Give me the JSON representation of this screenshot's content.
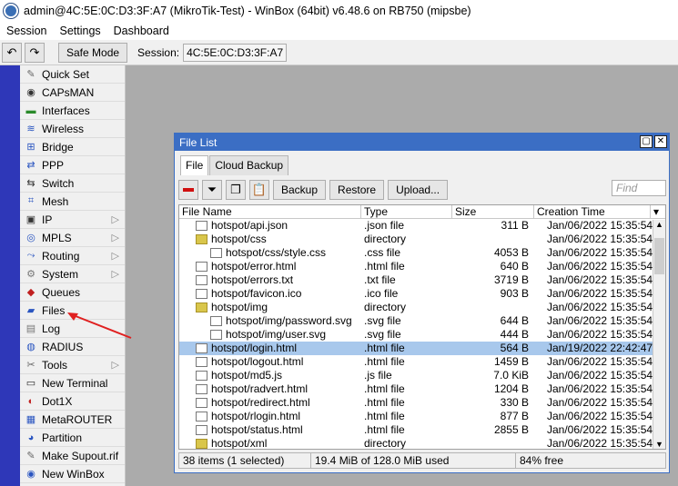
{
  "window_title": "admin@4C:5E:0C:D3:3F:A7 (MikroTik-Test) - WinBox (64bit) v6.48.6 on RB750 (mipsbe)",
  "menu": [
    "Session",
    "Settings",
    "Dashboard"
  ],
  "toolbar": {
    "undo_icon": "undo-icon",
    "redo_icon": "redo-icon",
    "safe_mode": "Safe Mode",
    "session_label": "Session:",
    "session_value": "4C:5E:0C:D3:3F:A7"
  },
  "sidebar": [
    {
      "label": "Quick Set",
      "icon": "wand-icon",
      "arrow": false
    },
    {
      "label": "CAPsMAN",
      "icon": "capsman-icon",
      "arrow": false
    },
    {
      "label": "Interfaces",
      "icon": "interfaces-icon",
      "arrow": false
    },
    {
      "label": "Wireless",
      "icon": "wireless-icon",
      "arrow": false
    },
    {
      "label": "Bridge",
      "icon": "bridge-icon",
      "arrow": false
    },
    {
      "label": "PPP",
      "icon": "ppp-icon",
      "arrow": false
    },
    {
      "label": "Switch",
      "icon": "switch-icon",
      "arrow": false
    },
    {
      "label": "Mesh",
      "icon": "mesh-icon",
      "arrow": false
    },
    {
      "label": "IP",
      "icon": "ip-icon",
      "arrow": true
    },
    {
      "label": "MPLS",
      "icon": "mpls-icon",
      "arrow": true
    },
    {
      "label": "Routing",
      "icon": "routing-icon",
      "arrow": true
    },
    {
      "label": "System",
      "icon": "gear-icon",
      "arrow": true
    },
    {
      "label": "Queues",
      "icon": "queues-icon",
      "arrow": false
    },
    {
      "label": "Files",
      "icon": "folder-icon",
      "arrow": false
    },
    {
      "label": "Log",
      "icon": "log-icon",
      "arrow": false
    },
    {
      "label": "RADIUS",
      "icon": "radius-icon",
      "arrow": false
    },
    {
      "label": "Tools",
      "icon": "tools-icon",
      "arrow": true
    },
    {
      "label": "New Terminal",
      "icon": "terminal-icon",
      "arrow": false
    },
    {
      "label": "Dot1X",
      "icon": "dot1x-icon",
      "arrow": false
    },
    {
      "label": "MetaROUTER",
      "icon": "metarouter-icon",
      "arrow": false
    },
    {
      "label": "Partition",
      "icon": "partition-icon",
      "arrow": false
    },
    {
      "label": "Make Supout.rif",
      "icon": "supout-icon",
      "arrow": false
    },
    {
      "label": "New WinBox",
      "icon": "winbox-icon",
      "arrow": false
    }
  ],
  "file_window": {
    "title": "File List",
    "tabs": [
      "File",
      "Cloud Backup"
    ],
    "buttons": {
      "backup": "Backup",
      "restore": "Restore",
      "upload": "Upload..."
    },
    "find_placeholder": "Find",
    "columns": [
      "File Name",
      "Type",
      "Size",
      "Creation Time"
    ],
    "rows": [
      {
        "name": "hotspot/api.json",
        "type": ".json file",
        "size": "311 B",
        "time": "Jan/06/2022 15:35:54",
        "kind": "file",
        "indent": 0
      },
      {
        "name": "hotspot/css",
        "type": "directory",
        "size": "",
        "time": "Jan/06/2022 15:35:54",
        "kind": "dir",
        "indent": 0
      },
      {
        "name": "hotspot/css/style.css",
        "type": ".css file",
        "size": "4053 B",
        "time": "Jan/06/2022 15:35:54",
        "kind": "file",
        "indent": 1
      },
      {
        "name": "hotspot/error.html",
        "type": ".html file",
        "size": "640 B",
        "time": "Jan/06/2022 15:35:54",
        "kind": "file",
        "indent": 0
      },
      {
        "name": "hotspot/errors.txt",
        "type": ".txt file",
        "size": "3719 B",
        "time": "Jan/06/2022 15:35:54",
        "kind": "file",
        "indent": 0
      },
      {
        "name": "hotspot/favicon.ico",
        "type": ".ico file",
        "size": "903 B",
        "time": "Jan/06/2022 15:35:54",
        "kind": "file",
        "indent": 0
      },
      {
        "name": "hotspot/img",
        "type": "directory",
        "size": "",
        "time": "Jan/06/2022 15:35:54",
        "kind": "dir",
        "indent": 0
      },
      {
        "name": "hotspot/img/password.svg",
        "type": ".svg file",
        "size": "644 B",
        "time": "Jan/06/2022 15:35:54",
        "kind": "file",
        "indent": 1
      },
      {
        "name": "hotspot/img/user.svg",
        "type": ".svg file",
        "size": "444 B",
        "time": "Jan/06/2022 15:35:54",
        "kind": "file",
        "indent": 1
      },
      {
        "name": "hotspot/login.html",
        "type": ".html file",
        "size": "564 B",
        "time": "Jan/19/2022 22:42:47",
        "kind": "file",
        "indent": 0,
        "selected": true
      },
      {
        "name": "hotspot/logout.html",
        "type": ".html file",
        "size": "1459 B",
        "time": "Jan/06/2022 15:35:54",
        "kind": "file",
        "indent": 0
      },
      {
        "name": "hotspot/md5.js",
        "type": ".js file",
        "size": "7.0 KiB",
        "time": "Jan/06/2022 15:35:54",
        "kind": "file",
        "indent": 0
      },
      {
        "name": "hotspot/radvert.html",
        "type": ".html file",
        "size": "1204 B",
        "time": "Jan/06/2022 15:35:54",
        "kind": "file",
        "indent": 0
      },
      {
        "name": "hotspot/redirect.html",
        "type": ".html file",
        "size": "330 B",
        "time": "Jan/06/2022 15:35:54",
        "kind": "file",
        "indent": 0
      },
      {
        "name": "hotspot/rlogin.html",
        "type": ".html file",
        "size": "877 B",
        "time": "Jan/06/2022 15:35:54",
        "kind": "file",
        "indent": 0
      },
      {
        "name": "hotspot/status.html",
        "type": ".html file",
        "size": "2855 B",
        "time": "Jan/06/2022 15:35:54",
        "kind": "file",
        "indent": 0
      },
      {
        "name": "hotspot/xml",
        "type": "directory",
        "size": "",
        "time": "Jan/06/2022 15:35:54",
        "kind": "dir",
        "indent": 0
      }
    ],
    "status": {
      "count": "38 items (1 selected)",
      "usage": "19.4 MiB of 128.0 MiB used",
      "free": "84% free"
    }
  },
  "colors": {
    "accent": "#3b6ec4",
    "strip": "#2e37b8",
    "selection": "#a8c8ec",
    "arrow": "#e02020"
  }
}
